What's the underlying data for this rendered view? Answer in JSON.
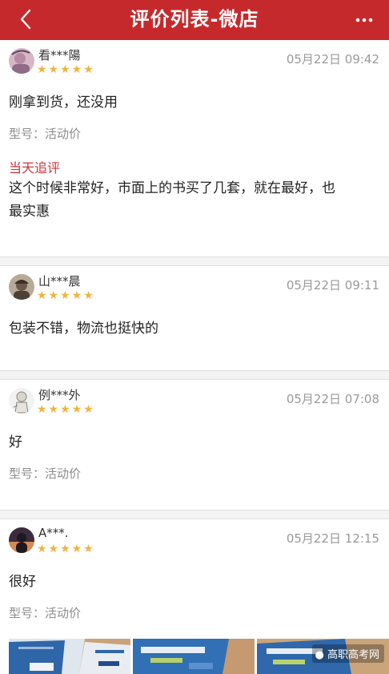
{
  "header": {
    "title": "评价列表-微店"
  },
  "reviews": [
    {
      "user": "看***陽",
      "stars": "★★★★★",
      "time": "05月22日 09:42",
      "content": "刚拿到货，还没用",
      "model": "型号：活动价",
      "follow_label": "当天追评",
      "follow_content_line1": "这个时候非常好，市面上的书买了几套，就在最好，也",
      "follow_content_line2": "最实惠"
    },
    {
      "user": "山***晨",
      "stars": "★★★★★",
      "time": "05月22日 09:11",
      "content": "包装不错，物流也挺快的"
    },
    {
      "user": "例***外",
      "stars": "★★★★★",
      "time": "05月22日 07:08",
      "content": "好",
      "model": "型号：活动价"
    },
    {
      "user": "A***.",
      "stars": "★★★★★",
      "time": "05月22日 12:15",
      "content": "很好",
      "model": "型号：活动价"
    }
  ],
  "watermark": "高职高考网",
  "colors": {
    "brand_red": "#c6292c",
    "star": "#f0b43c",
    "follow_red": "#d0353a"
  }
}
